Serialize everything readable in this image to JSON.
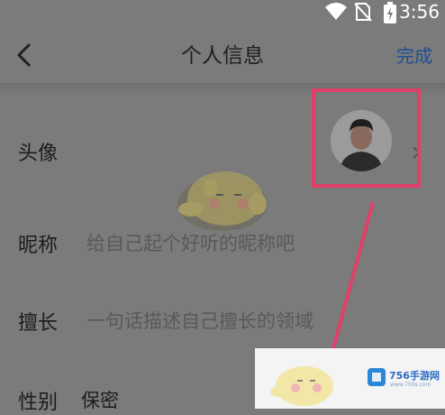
{
  "status_bar": {
    "time": "3:56",
    "icons": [
      "wifi-icon",
      "no-sim-icon",
      "battery-charging-icon"
    ]
  },
  "nav": {
    "title": "个人信息",
    "done_label": "完成",
    "back_icon": "chevron-left-icon"
  },
  "fields": {
    "avatar": {
      "label": "头像"
    },
    "nickname": {
      "label": "昵称",
      "placeholder": "给自己起个好听的昵称吧"
    },
    "expertise": {
      "label": "擅长",
      "placeholder": "一句话描述自己擅长的领域"
    },
    "gender": {
      "label": "性别",
      "value": "保密"
    }
  },
  "watermark": {
    "title": "756手游网",
    "subtitle": "www.756s.com"
  },
  "colors": {
    "highlight": "#e0406a",
    "done": "#1b4f96"
  }
}
